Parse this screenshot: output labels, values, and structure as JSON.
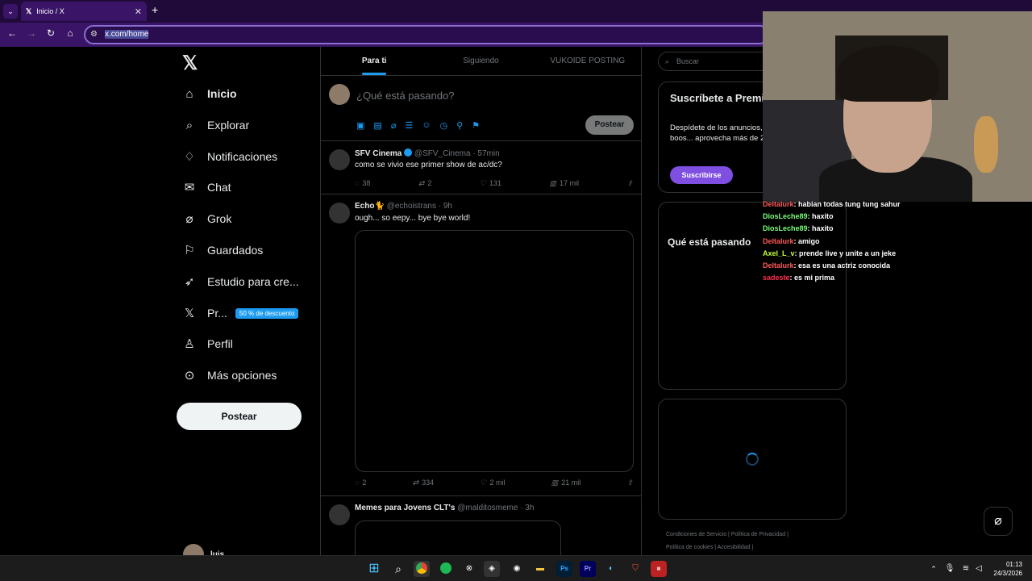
{
  "browser": {
    "tab_title": "Inicio / X",
    "tab_close": "✕",
    "new_tab": "+",
    "url": "x.com/home",
    "tab_favicon": "x-logo-icon"
  },
  "nav": {
    "logo": "𝕏",
    "items": [
      {
        "label": "Inicio",
        "icon": "home-icon",
        "glyph": "⌂"
      },
      {
        "label": "Explorar",
        "icon": "search-icon",
        "glyph": "⌕"
      },
      {
        "label": "Notificaciones",
        "icon": "bell-icon",
        "glyph": "♢"
      },
      {
        "label": "Chat",
        "icon": "mail-icon",
        "glyph": "✉"
      },
      {
        "label": "Grok",
        "icon": "grok-icon",
        "glyph": "⌀"
      },
      {
        "label": "Guardados",
        "icon": "bookmark-icon",
        "glyph": "⚐"
      },
      {
        "label": "Estudio para cre...",
        "icon": "rocket-icon",
        "glyph": "➶"
      },
      {
        "label": "Pr...",
        "icon": "x-premium-icon",
        "glyph": "𝕏",
        "badge": "50 % de descuento"
      },
      {
        "label": "Perfil",
        "icon": "person-icon",
        "glyph": "♙"
      },
      {
        "label": "Más opciones",
        "icon": "more-icon",
        "glyph": "⊙"
      }
    ],
    "post_button": "Postear",
    "account_name": "luis"
  },
  "feed": {
    "tabs": [
      "Para ti",
      "Siguiendo",
      "VUKOIDE POSTING"
    ],
    "compose_placeholder": "¿Qué está pasando?",
    "compose_post_button": "Postear",
    "posts": [
      {
        "name": "SFV Cinema",
        "handle": "@SFV_Cinema · 57min",
        "text": "como se vivio ese primer show de ac/dc?",
        "replies": "38",
        "reposts": "2",
        "likes": "131",
        "views": "17 mil"
      },
      {
        "name": "Echo🐈",
        "handle": "@echoistrans · 9h",
        "text": "ough... so eepy... bye bye world!",
        "replies": "2",
        "reposts": "334",
        "likes": "2 mil",
        "views": "21 mil"
      },
      {
        "name": "Memes para Jovens CLT's",
        "handle": "@malditosmeme · 3h",
        "text": ""
      }
    ]
  },
  "right": {
    "search_placeholder": "Buscar",
    "premium_title": "Suscríbete a Premium",
    "premium_text": "Despídete de los anuncios, estadísticas, aplica boos... aprovecha más de 20 car...",
    "premium_button": "Suscribirse",
    "trends_title": "Qué está pasando",
    "footer1": "Condiciones de Servicio  |  Política de Privacidad  |",
    "footer2": "Política de cookies  |  Accesibilidad  |"
  },
  "stream_chat": [
    {
      "user": "Deltalurk",
      "msg": ": habian todas tung tung sahur",
      "color": "#ff5a5a"
    },
    {
      "user": "DiosLeche89",
      "msg": ":  haxito",
      "color": "#7cff7c"
    },
    {
      "user": "DiosLeche89",
      "msg": ":  haxito",
      "color": "#7cff7c"
    },
    {
      "user": "Deltalurk",
      "msg": ": amigo",
      "color": "#ff5a5a"
    },
    {
      "user": "Axel_L_v",
      "msg": ": prende live y unite a un jeke",
      "color": "#c6ff3a"
    },
    {
      "user": "Deltalurk",
      "msg": ": esa es una actriz conocida",
      "color": "#ff5a5a"
    },
    {
      "user": "sadeste",
      "msg": ": es mi prima",
      "color": "#ff2f4f"
    }
  ],
  "taskbar": {
    "time": "01:13",
    "date": "24/3/2026"
  }
}
